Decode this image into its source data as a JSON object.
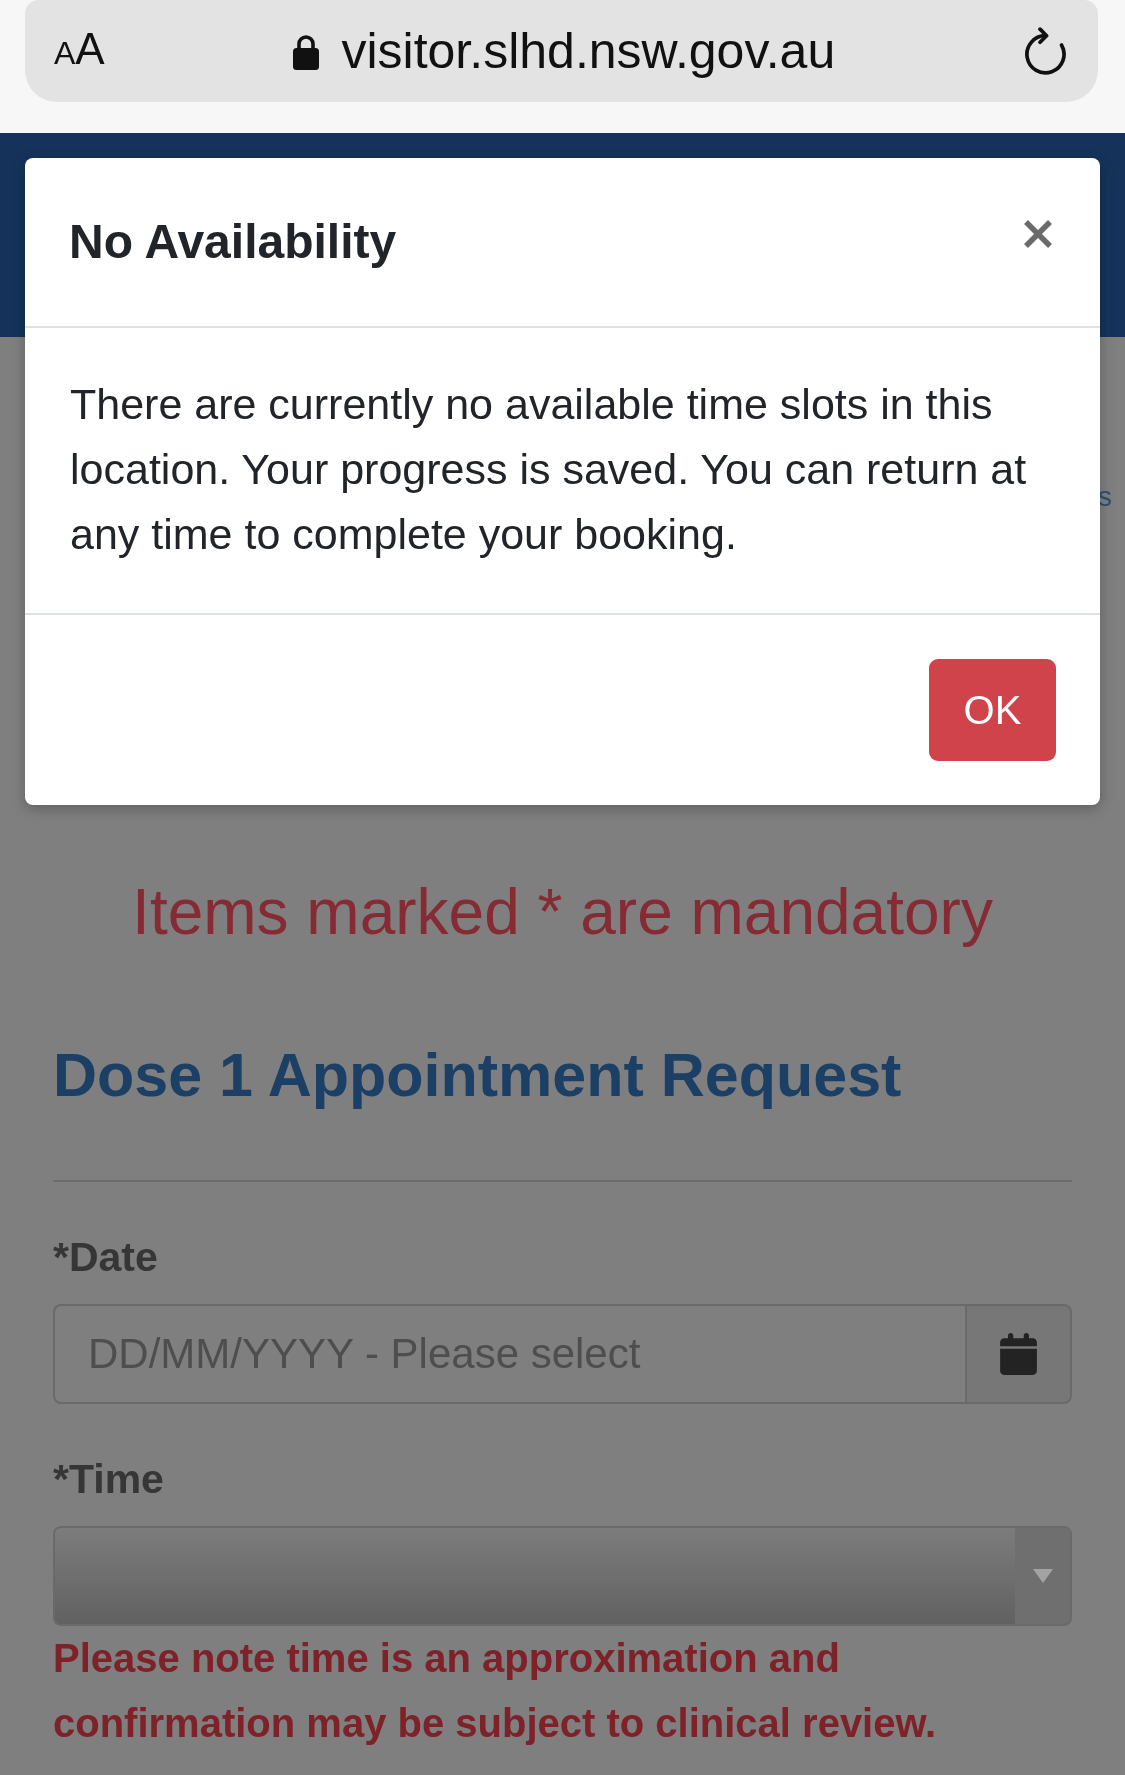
{
  "browser_bar": {
    "reader_label": "AA",
    "secure": true,
    "url": "visitor.slhd.nsw.gov.au"
  },
  "page": {
    "partial_text": "s",
    "mandatory_note": "Items marked * are mandatory",
    "section_title": "Dose 1 Appointment Request",
    "fields": [
      {
        "kind": "date",
        "label": "*Date",
        "placeholder": "DD/MM/YYYY - Please select"
      },
      {
        "kind": "select",
        "label": "*Time"
      }
    ],
    "time_note": "Please note time is an approximation and confirmation may be subject to clinical review."
  },
  "dialog": {
    "title": "No Availability",
    "message": "There are currently no available time slots in this location. Your progress is saved. You can return at any time to complete your booking.",
    "buttons": [
      "OK"
    ]
  }
}
